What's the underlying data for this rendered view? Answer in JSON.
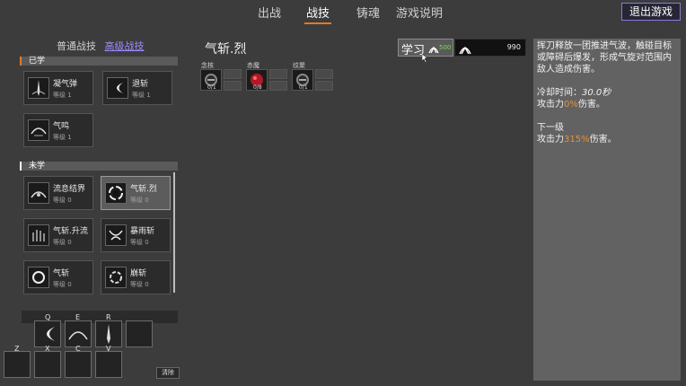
{
  "nav": {
    "tabs": [
      "出战",
      "战技",
      "铸魂",
      "游戏说明"
    ],
    "active": "战技",
    "exit": "退出游戏"
  },
  "skill_tabs": {
    "normal": "普通战技",
    "advanced": "高级战技"
  },
  "learned": {
    "header": "已学",
    "items": [
      {
        "name": "凝气弹",
        "level": "等级 1",
        "icon": "sword-burst-icon"
      },
      {
        "name": "退斩",
        "level": "等级 1",
        "icon": "crescent-slash-icon"
      },
      {
        "name": "气鸣",
        "level": "等级 1",
        "icon": "qi-wave-icon"
      }
    ]
  },
  "unlearned": {
    "header": "未学",
    "items": [
      {
        "name": "流息结界",
        "level": "等级 0",
        "icon": "barrier-icon"
      },
      {
        "name": "气斩.烈",
        "level": "等级 0",
        "icon": "vortex-icon"
      },
      {
        "name": "气斩.升流",
        "level": "等级 0",
        "icon": "rising-stream-icon"
      },
      {
        "name": "暴雨斩",
        "level": "等级 0",
        "icon": "storm-slash-icon"
      },
      {
        "name": "气斩",
        "level": "等级 0",
        "icon": "ring-slash-icon"
      },
      {
        "name": "崩斩",
        "level": "等级 0",
        "icon": "burst-ring-icon"
      }
    ]
  },
  "hotkeys": {
    "row1": [
      "Q",
      "E",
      "R",
      ""
    ],
    "row2": [
      "Z",
      "X",
      "C",
      "V"
    ],
    "clear": "清除"
  },
  "detail": {
    "title": "气斩.烈",
    "requirements": [
      {
        "label": "念核",
        "count": "0/1",
        "icon": "gear-core-icon"
      },
      {
        "label": "赤魔",
        "count": "0/8",
        "icon": "red-orb-icon"
      },
      {
        "label": "纹聚",
        "count": "0/1",
        "icon": "gear-core-icon"
      }
    ],
    "learn_label": "学习",
    "learn_cost": "500",
    "points": "990"
  },
  "info": {
    "desc": "挥刀释放一团推进气波，触碰目标或障碍后爆发，形成气旋对范围内敌人造成伤害。",
    "cooldown_label": "冷却时间：",
    "cooldown_value": "30.0秒",
    "attack_prefix": "攻击力",
    "attack_value": "0%",
    "attack_suffix": "伤害。",
    "next_label": "下一级",
    "next_prefix": "攻击力",
    "next_value": "315%",
    "next_suffix": "伤害。"
  }
}
